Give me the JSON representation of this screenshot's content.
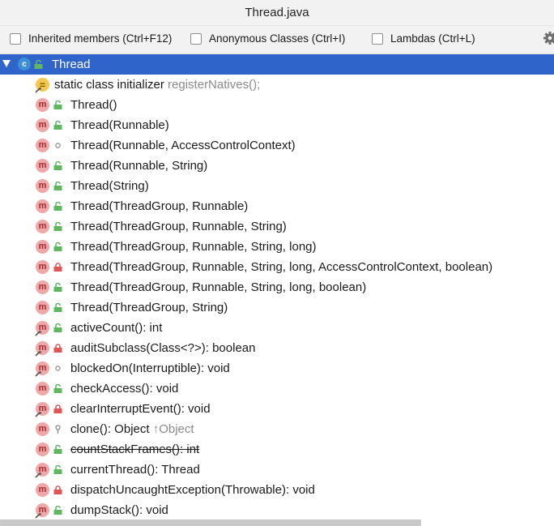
{
  "title": "Thread.java",
  "options": [
    {
      "label": "Inherited members (Ctrl+F12)",
      "checked": false
    },
    {
      "label": "Anonymous Classes (Ctrl+I)",
      "checked": false
    },
    {
      "label": "Lambdas (Ctrl+L)",
      "checked": false
    }
  ],
  "root": {
    "icon_letter": "c",
    "label": "Thread"
  },
  "rows": [
    {
      "kind": "static-init",
      "label": "static class initializer",
      "suffix": " registerNatives();",
      "access": "none"
    },
    {
      "kind": "method",
      "label": "Thread()",
      "access": "public"
    },
    {
      "kind": "method",
      "label": "Thread(Runnable)",
      "access": "public"
    },
    {
      "kind": "method",
      "label": "Thread(Runnable, AccessControlContext)",
      "access": "package"
    },
    {
      "kind": "method",
      "label": "Thread(Runnable, String)",
      "access": "public"
    },
    {
      "kind": "method",
      "label": "Thread(String)",
      "access": "public"
    },
    {
      "kind": "method",
      "label": "Thread(ThreadGroup, Runnable)",
      "access": "public"
    },
    {
      "kind": "method",
      "label": "Thread(ThreadGroup, Runnable, String)",
      "access": "public"
    },
    {
      "kind": "method",
      "label": "Thread(ThreadGroup, Runnable, String, long)",
      "access": "public"
    },
    {
      "kind": "method",
      "label": "Thread(ThreadGroup, Runnable, String, long, AccessControlContext, boolean)",
      "access": "private"
    },
    {
      "kind": "method",
      "label": "Thread(ThreadGroup, Runnable, String, long, boolean)",
      "access": "public"
    },
    {
      "kind": "method",
      "label": "Thread(ThreadGroup, String)",
      "access": "public"
    },
    {
      "kind": "method",
      "label": "activeCount(): int",
      "access": "public",
      "static": true
    },
    {
      "kind": "method",
      "label": "auditSubclass(Class<?>): boolean",
      "access": "private",
      "static": true
    },
    {
      "kind": "method",
      "label": "blockedOn(Interruptible): void",
      "access": "package",
      "static": true
    },
    {
      "kind": "method",
      "label": "checkAccess(): void",
      "access": "public"
    },
    {
      "kind": "method",
      "label": "clearInterruptEvent(): void",
      "access": "private",
      "static": true
    },
    {
      "kind": "method",
      "label": "clone(): Object",
      "suffix": " ↑Object",
      "access": "protected"
    },
    {
      "kind": "method",
      "label": "countStackFrames(): int",
      "access": "public",
      "deprecated": true
    },
    {
      "kind": "method",
      "label": "currentThread(): Thread",
      "access": "public",
      "static": true
    },
    {
      "kind": "method",
      "label": "dispatchUncaughtException(Throwable): void",
      "access": "private"
    },
    {
      "kind": "method",
      "label": "dumpStack(): void",
      "access": "public",
      "static": true
    }
  ],
  "colors": {
    "selection": "#2f65ca",
    "method_icon": "#f0a7a7",
    "public": "#5fb85f",
    "private": "#e05555"
  }
}
